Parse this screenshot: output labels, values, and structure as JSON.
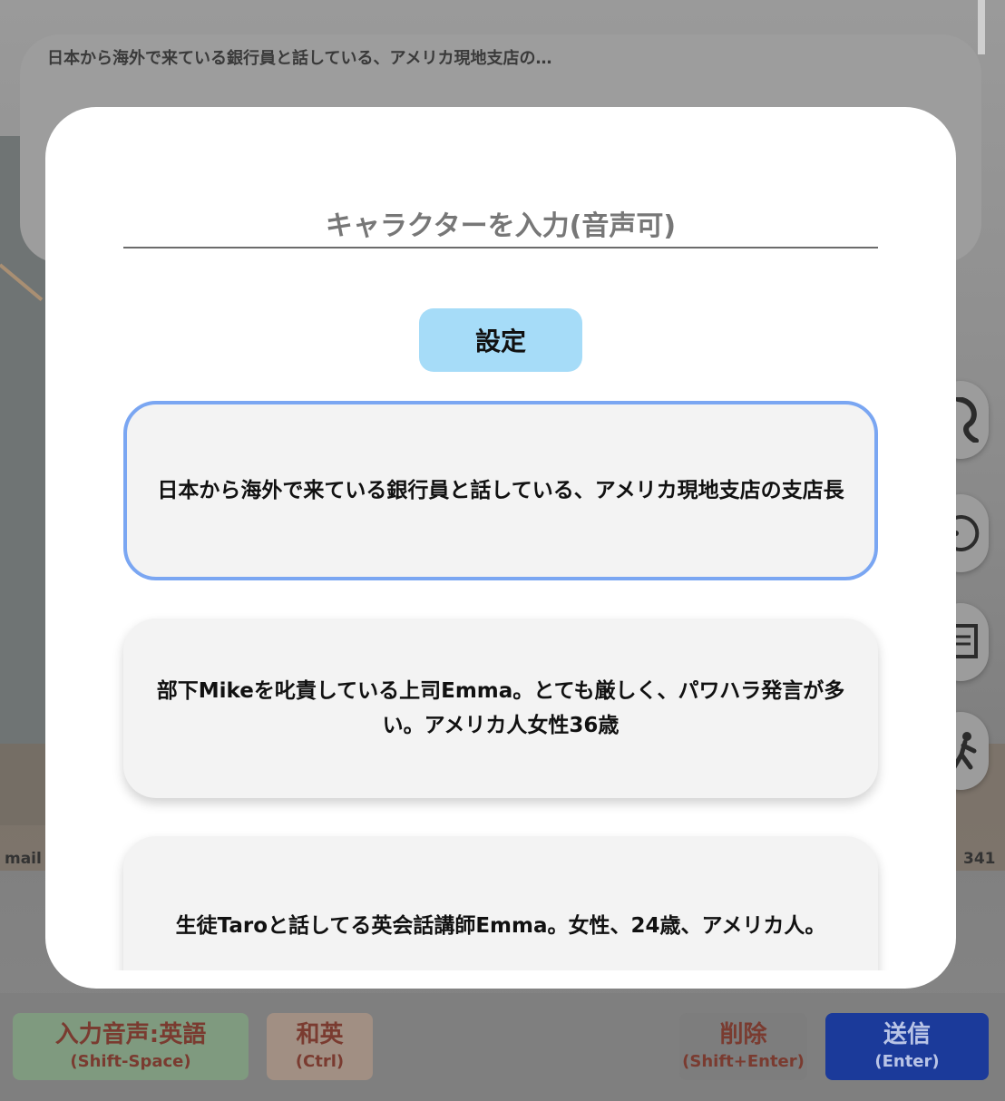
{
  "background": {
    "top_chat_text": "日本から海外で来ている銀行員と話している、アメリカ現地支店の…",
    "mail_label": "mail",
    "count_label": "341"
  },
  "modal": {
    "input_placeholder": "キャラクターを入力(音声可)",
    "set_button_label": "設定",
    "characters": [
      {
        "text": "日本から海外で来ている銀行員と話している、アメリカ現地支店の支店長",
        "selected": true
      },
      {
        "text": "部下Mikeを叱責している上司Emma。とても厳しく、パワハラ発言が多い。アメリカ人女性36歳",
        "selected": false
      },
      {
        "text": "生徒Taroと話してる英会話講師Emma。女性、24歳、アメリカ人。",
        "selected": false
      }
    ]
  },
  "bottom_buttons": {
    "voice": {
      "label": "入力音声:英語",
      "shortcut": "(Shift-Space)"
    },
    "translate": {
      "label": "和英",
      "shortcut": "(Ctrl)"
    },
    "delete": {
      "label": "削除",
      "shortcut": "(Shift+Enter)"
    },
    "send": {
      "label": "送信",
      "shortcut": "(Enter)"
    }
  },
  "colors": {
    "accent_selected_border": "#7aa6f2",
    "set_button": "#a6dcf8",
    "send_button": "#1b3a9a"
  }
}
